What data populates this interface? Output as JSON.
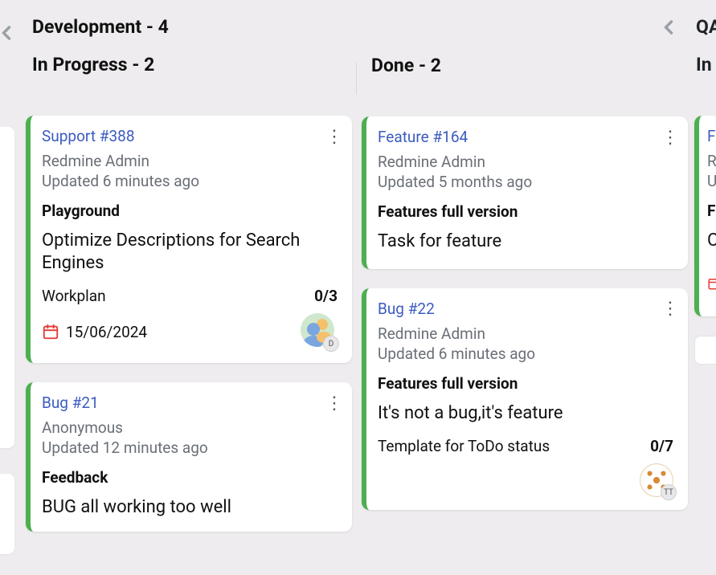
{
  "columns": {
    "dev": {
      "title": "Development - 4"
    },
    "qa": {
      "title": "QA"
    }
  },
  "statuses": {
    "in_progress": "In Progress - 2",
    "done": "Done - 2",
    "qa_in": "In"
  },
  "cards": {
    "c388": {
      "link": "Support #388",
      "author": "Redmine Admin",
      "updated": "Updated 6 minutes ago",
      "version": "Playground",
      "title": "Optimize Descriptions for Search Engines",
      "checklist_label": "Workplan",
      "progress": "0/3",
      "due": "15/06/2024",
      "assignee_badge": "D"
    },
    "c21": {
      "link": "Bug #21",
      "author": "Anonymous",
      "updated": "Updated 12 minutes ago",
      "version": "Feedback",
      "title": "BUG all working too well"
    },
    "c164": {
      "link": "Feature #164",
      "author": "Redmine Admin",
      "updated": "Updated 5 months ago",
      "version": "Features full version",
      "title": "Task for feature"
    },
    "c22": {
      "link": "Bug #22",
      "author": "Redmine Admin",
      "updated": "Updated 6 minutes ago",
      "version": "Features full version",
      "title": "It's not a bug,it's feature",
      "checklist_label": "Template for ToDo status",
      "progress": "0/7",
      "assignee_badge": "TT"
    },
    "partial_right": {
      "author_initial": "R",
      "updated_initial": "U",
      "version_initial": "F",
      "title_initial": "C"
    }
  }
}
